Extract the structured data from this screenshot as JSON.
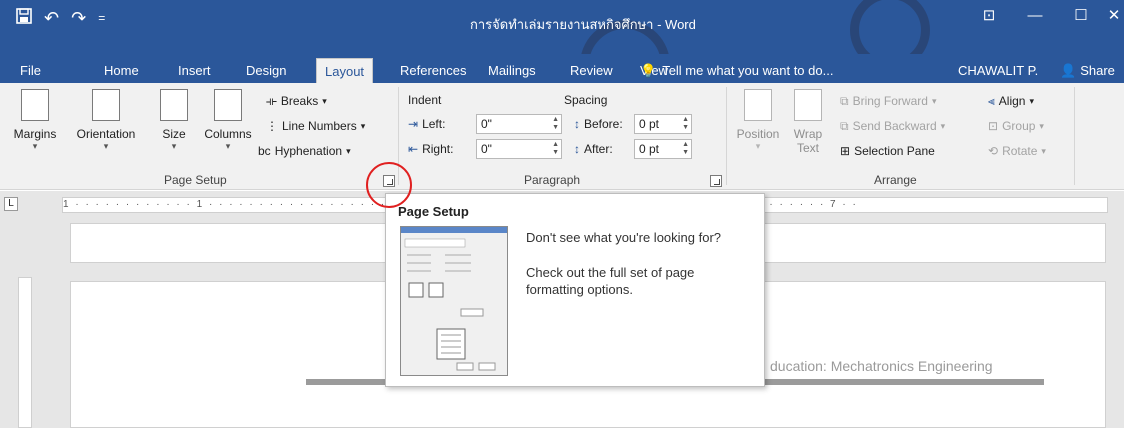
{
  "window": {
    "title": "การจัดทำเล่มรายงานสหกิจศึกษา - Word",
    "qat_save_icon": "save-icon",
    "qat_undo": "↶",
    "qat_redo": "↷",
    "qat_customize": "="
  },
  "tabs": [
    {
      "label": "File"
    },
    {
      "label": "Home"
    },
    {
      "label": "Insert"
    },
    {
      "label": "Design"
    },
    {
      "label": "Layout"
    },
    {
      "label": "References"
    },
    {
      "label": "Mailings"
    },
    {
      "label": "Review"
    },
    {
      "label": "View"
    }
  ],
  "tell_me": "Tell me what you want to do...",
  "user": "CHAWALIT P.",
  "share": "Share",
  "page_setup": {
    "margins": "Margins",
    "orientation": "Orientation",
    "size": "Size",
    "columns": "Columns",
    "breaks": "Breaks",
    "line_numbers": "Line Numbers",
    "hyphenation": "Hyphenation",
    "group_label": "Page Setup"
  },
  "paragraph": {
    "indent_label": "Indent",
    "spacing_label": "Spacing",
    "left_label": "Left:",
    "left_value": "0\"",
    "right_label": "Right:",
    "right_value": "0\"",
    "before_label": "Before:",
    "before_value": "0 pt",
    "after_label": "After:",
    "after_value": "0 pt",
    "group_label": "Paragraph"
  },
  "arrange": {
    "position": "Position",
    "wrap_text": "Wrap Text",
    "bring_forward": "Bring Forward",
    "send_backward": "Send Backward",
    "selection_pane": "Selection Pane",
    "align": "Align",
    "group": "Group",
    "rotate": "Rotate",
    "group_label": "Arrange"
  },
  "ruler": {
    "marks": "1 · · · · · · · · · · · · 1 · · · · · · · · · · · · · · · · · · · · · · · · · · · · · · · · · · · · · · · · · 5 · · · · · · · · · · 6 · · · · · · · · 7 · ·"
  },
  "tooltip": {
    "title": "Page Setup",
    "line1": "Don't see what you're looking for?",
    "line2": "Check out the full set of page formatting options."
  },
  "document": {
    "footer_text": "ducation: Mechatronics Engineering"
  },
  "colors": {
    "ribbon_blue": "#2b579a",
    "highlight_red": "#e02020"
  }
}
